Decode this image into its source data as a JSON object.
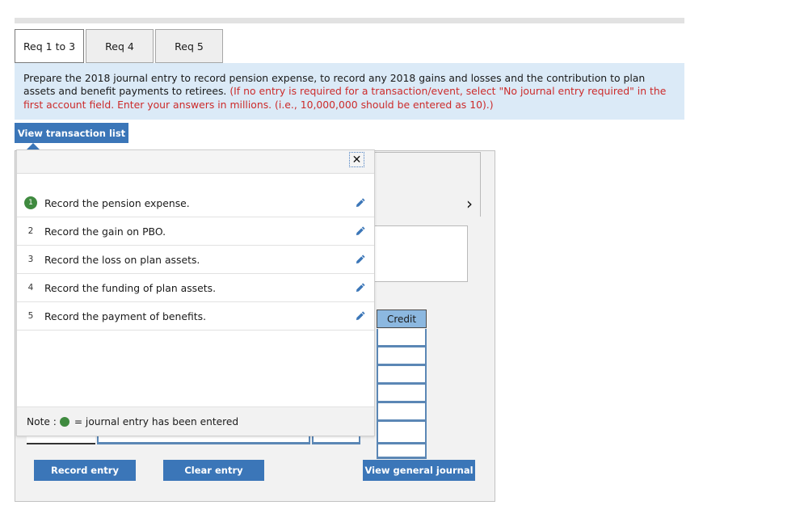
{
  "tabs": [
    {
      "label": "Req 1 to 3",
      "active": true
    },
    {
      "label": "Req 4",
      "active": false
    },
    {
      "label": "Req 5",
      "active": false
    }
  ],
  "instructions": {
    "black_part": "Prepare the 2018 journal entry to record pension expense, to record any 2018 gains and losses and the contribution to plan assets and benefit payments to retirees. ",
    "red_part": "(If no entry is required for a transaction/event, select \"No journal entry required\" in the first account field. Enter your answers in millions. (i.e., 10,000,000 should be entered as 10).)"
  },
  "toolbar": {
    "view_transaction_list_label": "View transaction list"
  },
  "worksheet": {
    "next_chevron": "›",
    "credit_header": "Credit",
    "credit_rows": 7,
    "totals_segments": 4
  },
  "popup": {
    "close_label": "✕",
    "note_prefix": "Note :",
    "note_text": "= journal entry has been entered",
    "transactions": [
      {
        "num": "1",
        "entered": true,
        "text": "Record the pension expense."
      },
      {
        "num": "2",
        "entered": false,
        "text": "Record the gain on PBO."
      },
      {
        "num": "3",
        "entered": false,
        "text": "Record the loss on plan assets."
      },
      {
        "num": "4",
        "entered": false,
        "text": "Record the funding of plan assets."
      },
      {
        "num": "5",
        "entered": false,
        "text": "Record the payment of benefits."
      }
    ]
  },
  "actions": {
    "record_entry": "Record entry",
    "clear_entry": "Clear entry",
    "view_general_journal": "View general journal"
  },
  "colors": {
    "accent_blue": "#3b76b8",
    "instruction_bg": "#dbeaf7",
    "instruction_red": "#cc2b2b",
    "entered_green": "#3f8a3f",
    "credit_header_blue": "#8cb8e0",
    "cell_border_blue": "#5b87b5"
  }
}
